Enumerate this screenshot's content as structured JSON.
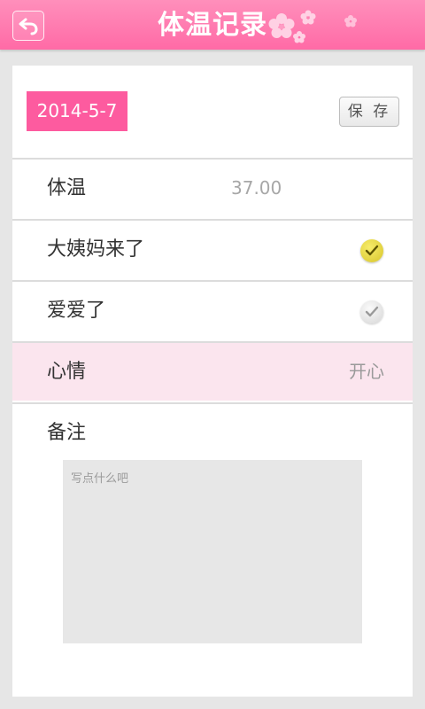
{
  "header": {
    "title": "体温记录",
    "back_icon": "back-arrow-icon"
  },
  "record": {
    "date": "2014-5-7",
    "save_label": "保 存"
  },
  "rows": {
    "temperature": {
      "label": "体温",
      "value": "37.00"
    },
    "period": {
      "label": "大姨妈来了",
      "checked": true
    },
    "love": {
      "label": "爱爱了",
      "checked": false
    },
    "mood": {
      "label": "心情",
      "value": "开心"
    },
    "notes": {
      "label": "备注",
      "placeholder": "写点什么吧",
      "value": ""
    }
  },
  "colors": {
    "accent": "#fd5b9f",
    "header": "#ff78ad",
    "mood_bg": "#fbe5ee"
  }
}
